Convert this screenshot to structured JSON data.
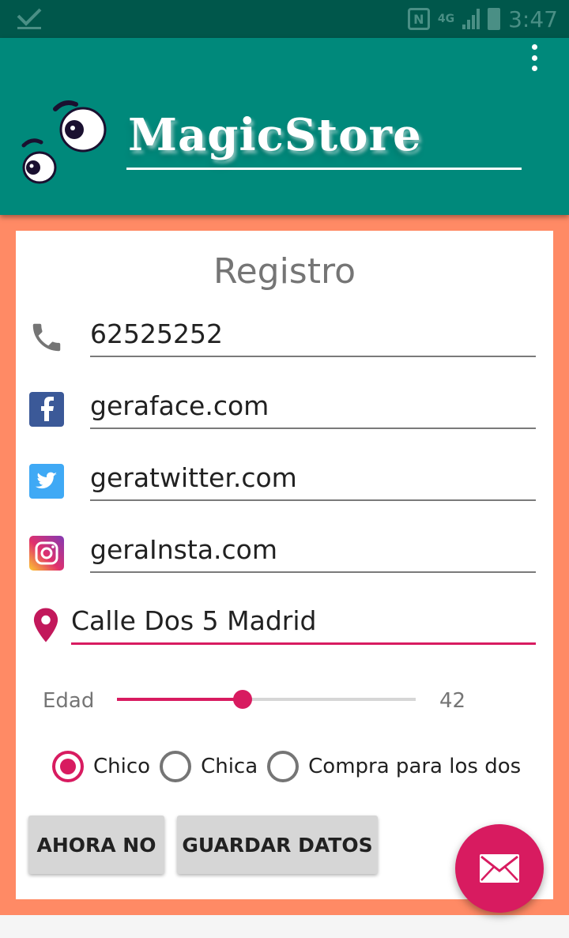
{
  "status_bar": {
    "time": "3:47",
    "network": "4G",
    "nfc": "N"
  },
  "app_bar": {
    "title": "MagicStore"
  },
  "form": {
    "title": "Registro",
    "phone": "62525252",
    "facebook": "geraface.com",
    "twitter": "geratwitter.com",
    "instagram": "geraInsta.com",
    "address": "Calle Dos 5 Madrid",
    "age": {
      "label": "Edad",
      "value": "42",
      "fraction": 0.42
    },
    "gender_options": [
      {
        "label": "Chico",
        "checked": true
      },
      {
        "label": "Chica",
        "checked": false
      },
      {
        "label": "Compra para los dos",
        "checked": false
      }
    ],
    "buttons": {
      "later": "AHORA NO",
      "save": "GUARDAR DATOS"
    }
  },
  "colors": {
    "primary": "#00897b",
    "primary_dark": "#00574b",
    "accent": "#d81b60",
    "background": "#ff8a65"
  },
  "icons": [
    "check-icon",
    "more-vert-icon",
    "eyes-logo",
    "phone-icon",
    "facebook-icon",
    "twitter-icon",
    "instagram-icon",
    "location-pin-icon",
    "email-icon"
  ]
}
